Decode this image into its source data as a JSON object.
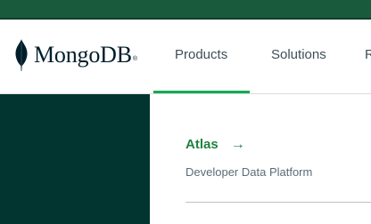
{
  "logo": {
    "text": "MongoDB",
    "registered": "®",
    "leaf_icon": "mongodb-leaf-icon"
  },
  "nav": {
    "items": [
      {
        "label": "Products",
        "active": true
      },
      {
        "label": "Solutions",
        "active": false
      },
      {
        "label": "R",
        "active": false
      }
    ]
  },
  "products_menu": {
    "atlas": {
      "title": "Atlas",
      "arrow": "→",
      "description": "Developer Data Platform"
    }
  },
  "colors": {
    "topbar": "#1a5a3c",
    "panel": "#023430",
    "accent_green": "#13aa52",
    "link_green": "#21813f"
  }
}
